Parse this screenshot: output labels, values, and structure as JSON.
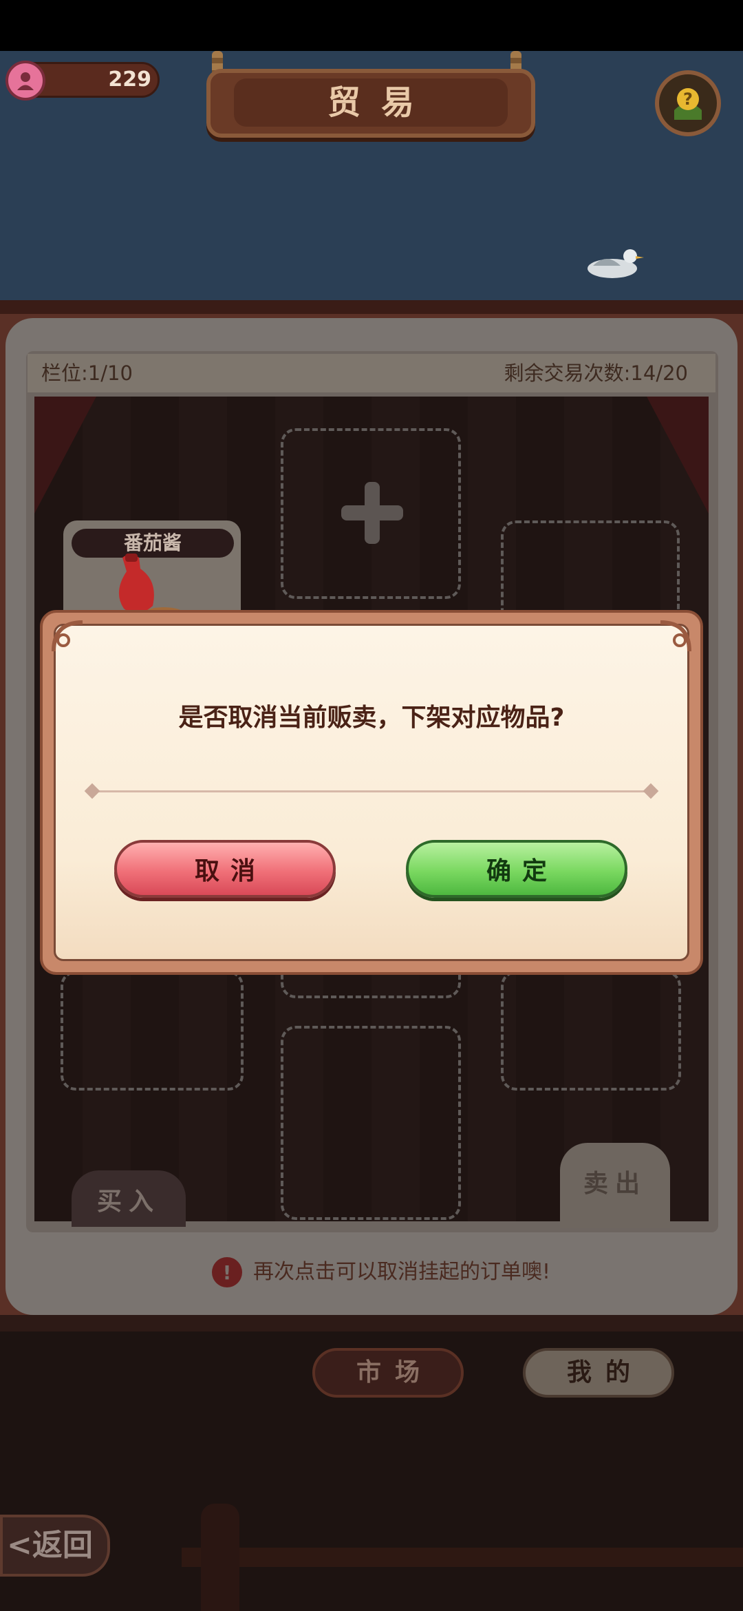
{
  "header": {
    "coins": "229",
    "title": "贸易"
  },
  "panel": {
    "slots": "栏位:1/10",
    "remaining_trades": "剩余交易次数:14/20",
    "item_name": "番茄酱",
    "buy_tab": "买入",
    "sell_tab": "卖出",
    "hint": "再次点击可以取消挂起的订单噢!"
  },
  "bottom_nav": {
    "market": "市场",
    "mine": "我的",
    "back": "<返回"
  },
  "dialog": {
    "message": "是否取消当前贩卖，下架对应物品?",
    "cancel": "取消",
    "confirm": "确定"
  },
  "colors": {
    "confirm_green": "#7ad860",
    "cancel_red": "#f07078",
    "dialog_bg": "#fdf4e6"
  }
}
